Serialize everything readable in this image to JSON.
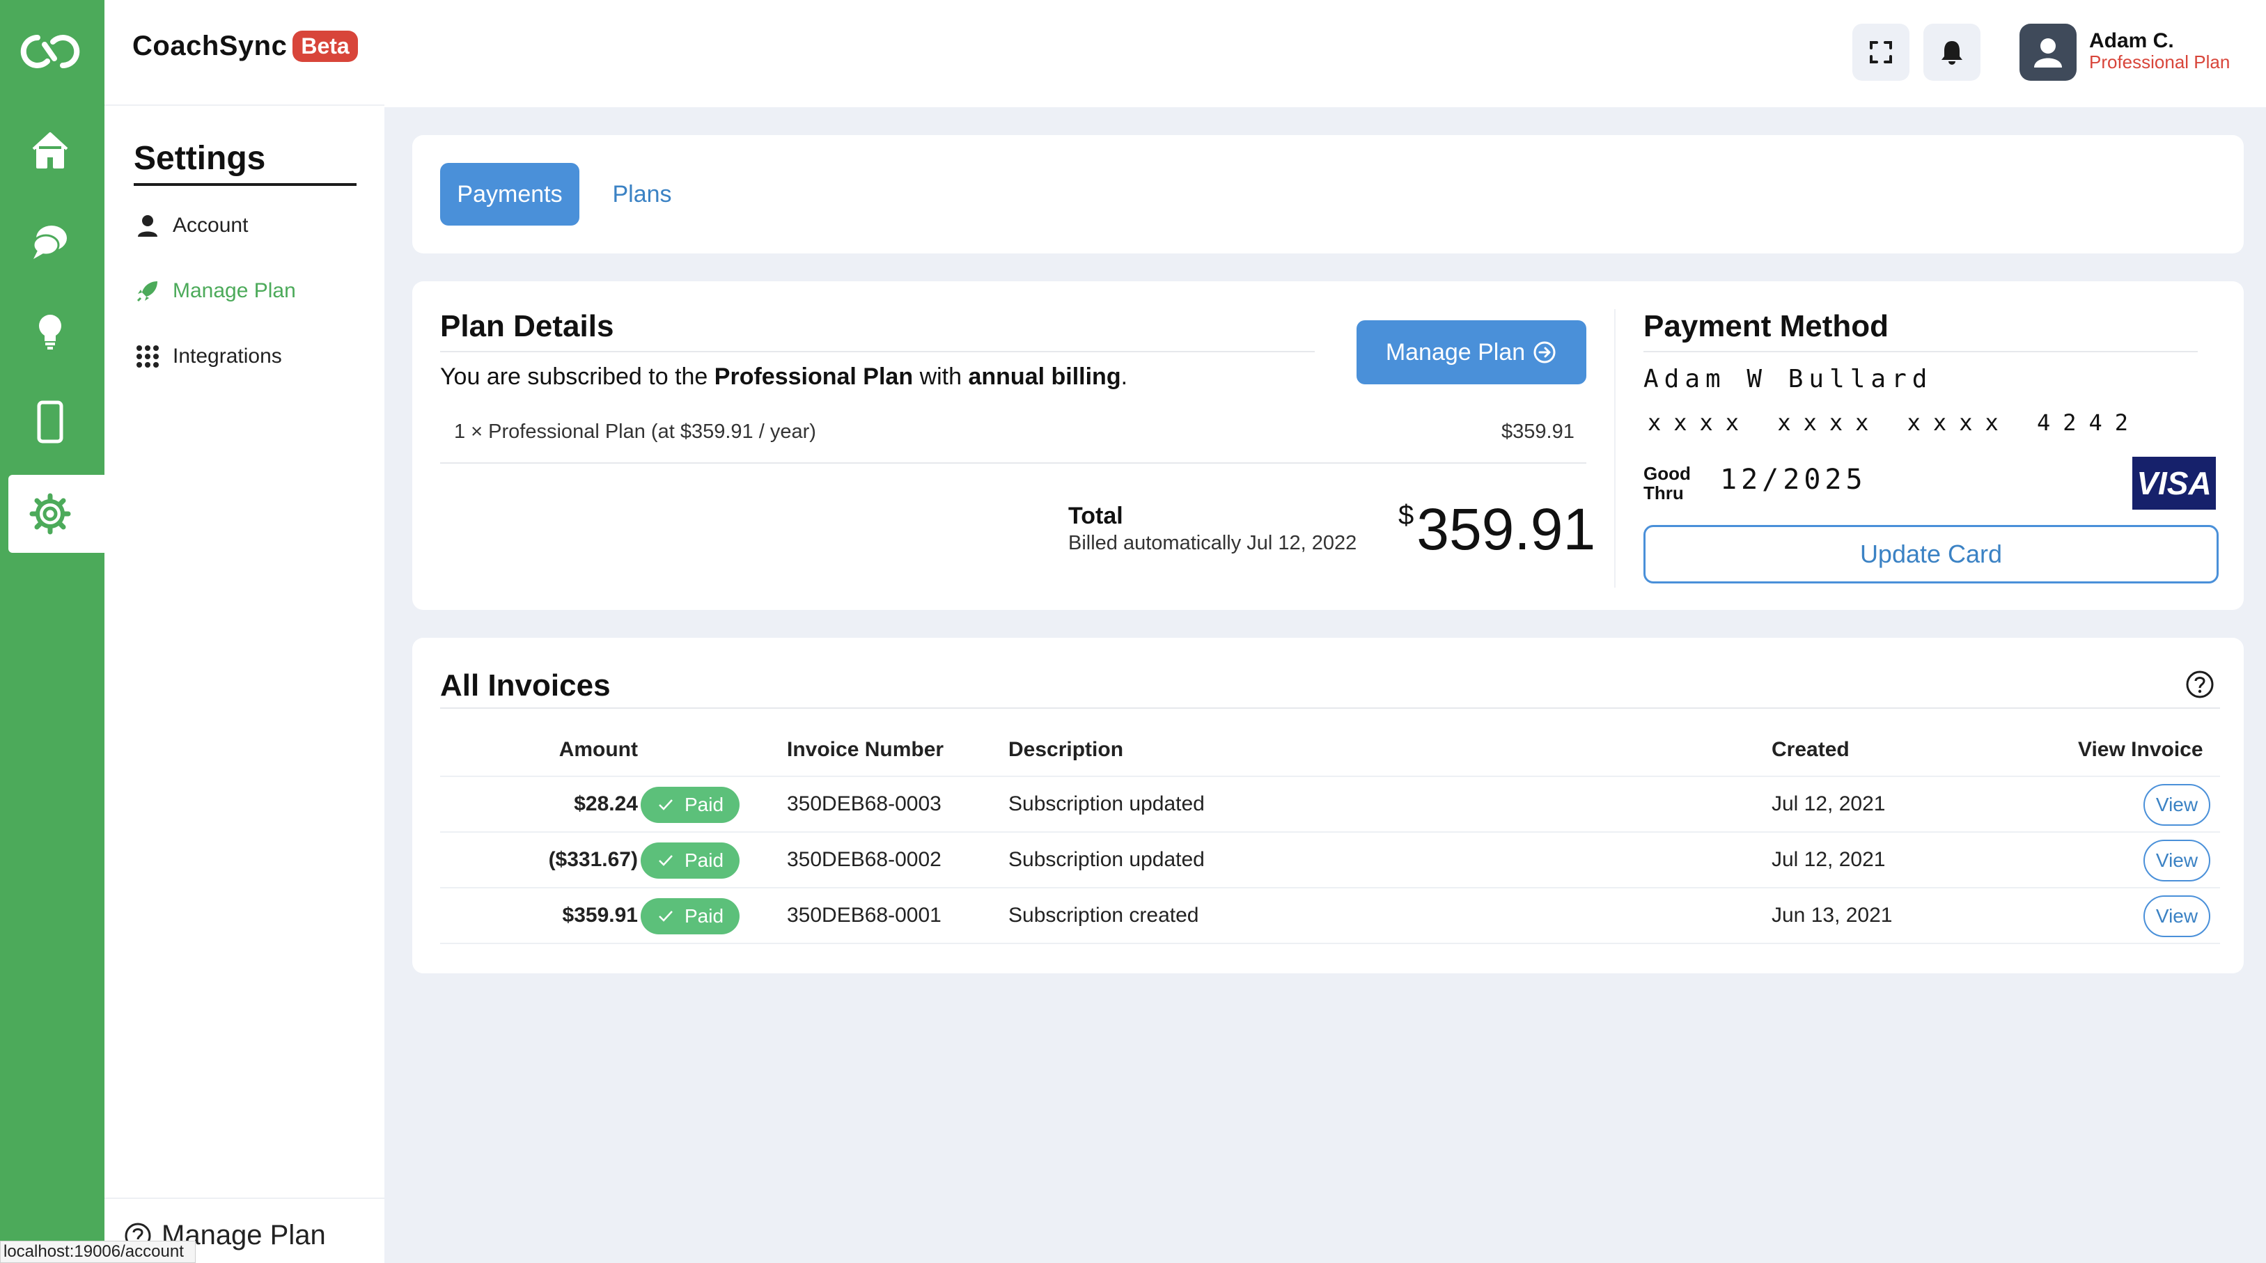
{
  "app": {
    "name": "CoachSync",
    "badge": "Beta"
  },
  "rail": {
    "icons": [
      "coachsync-logo-icon",
      "home-icon",
      "chat-icon",
      "lightbulb-icon",
      "mobile-icon",
      "settings-gear-icon"
    ],
    "active": "settings-gear-icon",
    "brand_color": "#4caa5a"
  },
  "settings": {
    "title": "Settings",
    "items": [
      {
        "label": "Account",
        "icon": "user-icon"
      },
      {
        "label": "Manage Plan",
        "icon": "rocket-icon"
      },
      {
        "label": "Integrations",
        "icon": "grid-dots-icon"
      }
    ],
    "footer_item": {
      "label": "Manage Plan",
      "icon": "help-circle-icon"
    }
  },
  "status_bar": {
    "url": "localhost:19006/account"
  },
  "header": {
    "user_name": "Adam C.",
    "user_plan": "Professional Plan",
    "icons": [
      "fullscreen-icon",
      "bell-icon",
      "avatar-user-icon"
    ]
  },
  "tabs": [
    {
      "label": "Payments"
    },
    {
      "label": "Plans"
    }
  ],
  "plan_details": {
    "title": "Plan Details",
    "subscribed_prefix": "You are subscribed to the ",
    "plan_name": "Professional Plan",
    "subscribed_mid": " with ",
    "billing": "annual billing",
    "subscribed_suffix": ".",
    "line_item": "1 × Professional Plan (at $359.91 / year)",
    "line_price": "$359.91",
    "total_label": "Total",
    "total_sub": "Billed automatically Jul 12, 2022",
    "total_currency": "$",
    "total_amount": "359.91",
    "manage_button": "Manage Plan"
  },
  "payment_method": {
    "title": "Payment Method",
    "card_name": "Adam W Bullard",
    "card_number": "xxxx xxxx xxxx 4242",
    "good_thru_line1": "Good",
    "good_thru_line2": "Thru",
    "expiry": "12/2025",
    "brand": "VISA",
    "update_button": "Update Card"
  },
  "invoices": {
    "title": "All Invoices",
    "columns": [
      "Amount",
      "Invoice Number",
      "Description",
      "Created",
      "View Invoice"
    ],
    "rows": [
      {
        "amount": "$28.24",
        "status": "Paid",
        "number": "350DEB68-0003",
        "description": "Subscription updated",
        "created": "Jul 12, 2021",
        "view": "View"
      },
      {
        "amount": "($331.67)",
        "status": "Paid",
        "number": "350DEB68-0002",
        "description": "Subscription updated",
        "created": "Jul 12, 2021",
        "view": "View"
      },
      {
        "amount": "$359.91",
        "status": "Paid",
        "number": "350DEB68-0001",
        "description": "Subscription created",
        "created": "Jun 13, 2021",
        "view": "View"
      }
    ]
  }
}
